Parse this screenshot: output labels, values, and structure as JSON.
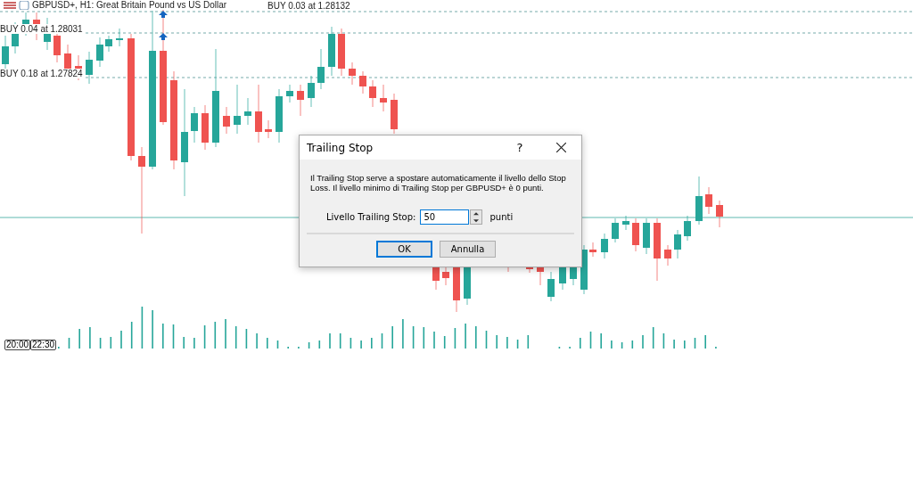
{
  "chart": {
    "title": "GBPUSD+, H1:  Great Britain Pound vs US Dollar",
    "order_lines": [
      {
        "label": "BUY 0.03 at 1.28132"
      },
      {
        "label": "BUY 0.04 at 1.28031"
      },
      {
        "label": "BUY 0.18 at 1.27824"
      }
    ],
    "time_labels": [
      "20:00",
      "22:30"
    ]
  },
  "dialog": {
    "title": "Trailing Stop",
    "help": "?",
    "message": "Il Trailing Stop serve a spostare automaticamente il livello dello Stop Loss. Il livello minimo di Trailing Stop per GBPUSD+ è 0 punti.",
    "field": {
      "label": "Livello Trailing Stop:",
      "value": "50",
      "unit": "punti"
    },
    "buttons": [
      {
        "label": "OK",
        "focused": true
      },
      {
        "label": "Annulla",
        "focused": false
      }
    ]
  }
}
